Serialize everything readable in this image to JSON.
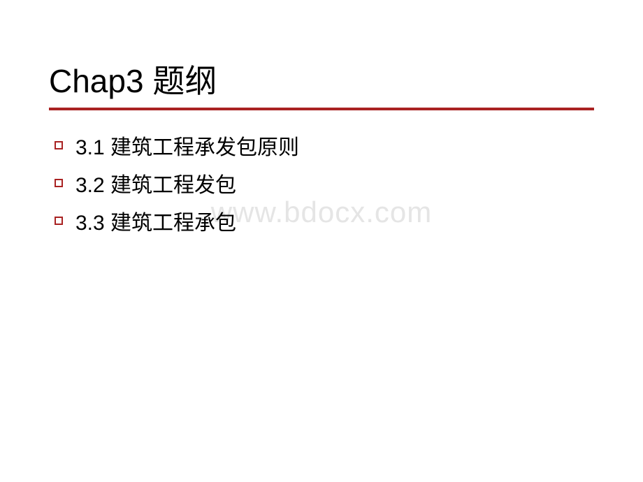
{
  "slide": {
    "title": "Chap3    题纲",
    "items": [
      {
        "label": "3.1 建筑工程承发包原则"
      },
      {
        "label": "3.2 建筑工程发包"
      },
      {
        "label": "3.3 建筑工程承包"
      }
    ]
  },
  "watermark": "www.bdocx.com"
}
